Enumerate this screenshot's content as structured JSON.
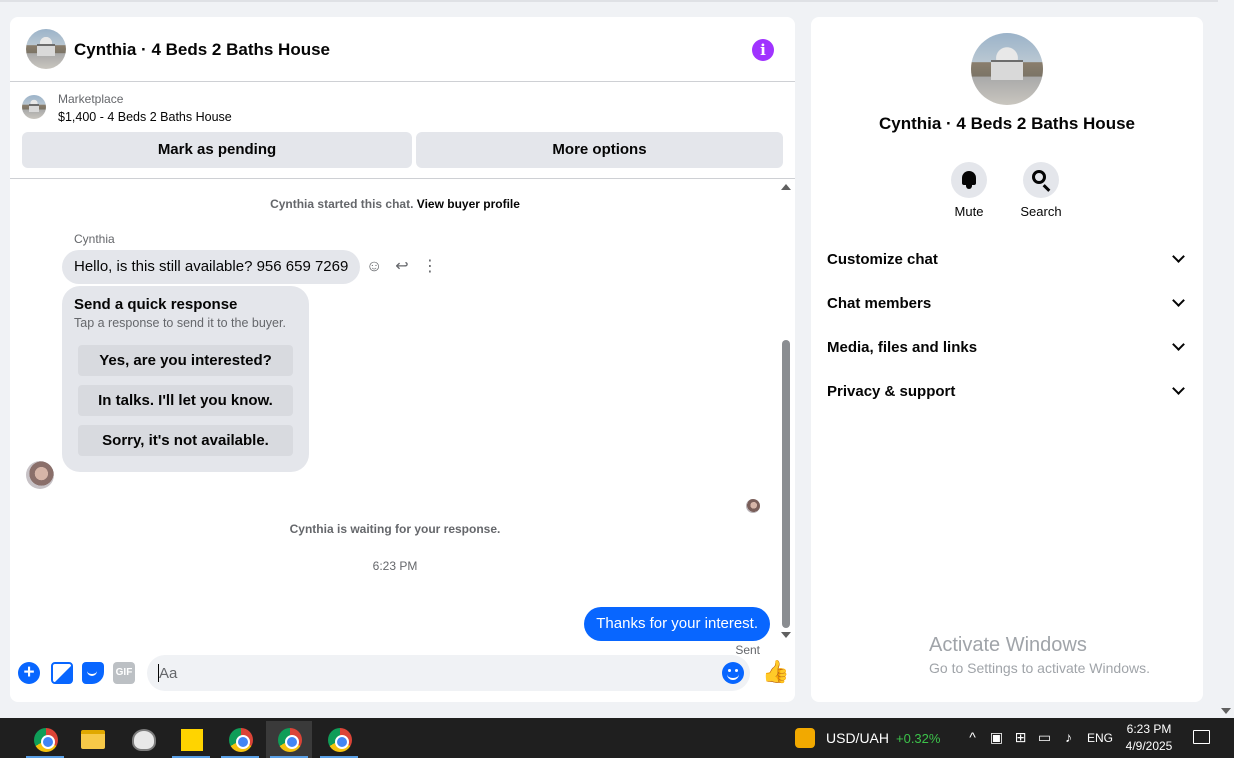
{
  "header": {
    "title": "Cynthia · 4 Beds 2 Baths House",
    "info_icon": "i"
  },
  "listing": {
    "source": "Marketplace",
    "price_title": "$1,400 - 4 Beds 2 Baths House",
    "mark_pending_label": "Mark as pending",
    "more_options_label": "More options"
  },
  "conversation": {
    "start_notice": "Cynthia started this chat.",
    "buyer_profile_link": "View buyer profile",
    "sender_name": "Cynthia",
    "incoming_message": "Hello, is this still available? 956 659 7269",
    "quick_response": {
      "title": "Send a quick response",
      "subtitle": "Tap a response to send it to the buyer.",
      "options": [
        "Yes, are you interested?",
        "In talks. I'll let you know.",
        "Sorry, it's not available."
      ]
    },
    "waiting_notice": "Cynthia is waiting for your response.",
    "timestamp": "6:23 PM",
    "outgoing_message": "Thanks for your interest.",
    "status": "Sent"
  },
  "composer": {
    "placeholder": "Aa",
    "gif_label": "GIF"
  },
  "info_panel": {
    "title": "Cynthia · 4 Beds 2 Baths House",
    "actions": [
      {
        "label": "Mute",
        "icon": "bell-icon"
      },
      {
        "label": "Search",
        "icon": "search-icon"
      }
    ],
    "sections": [
      "Customize chat",
      "Chat members",
      "Media, files and links",
      "Privacy & support"
    ]
  },
  "watermark": {
    "line1": "Activate Windows",
    "line2": "Go to Settings to activate Windows."
  },
  "taskbar": {
    "ticker_symbol": "USD/UAH",
    "ticker_change": "+0.32%",
    "language": "ENG",
    "time": "6:23 PM",
    "date": "4/9/2025"
  },
  "colors": {
    "accent": "#0866ff",
    "info": "#a033ff",
    "ticker_up": "#3cc24a"
  }
}
